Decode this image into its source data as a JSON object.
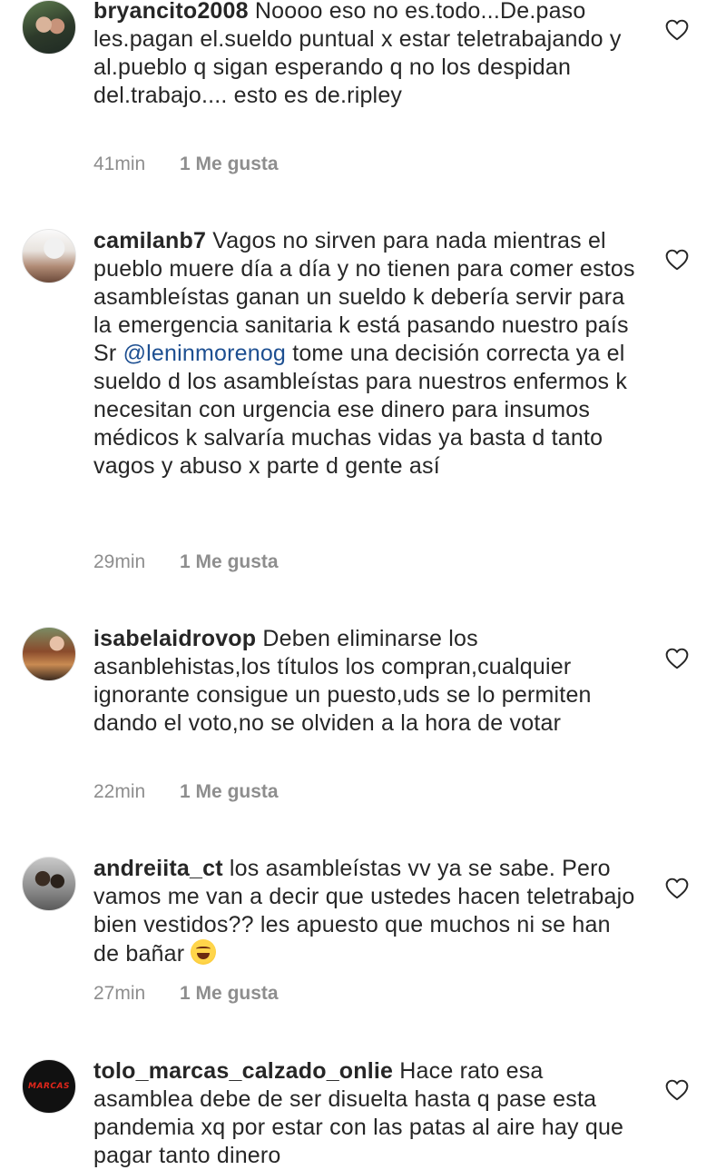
{
  "comments": [
    {
      "username": "bryancito2008",
      "text": "Noooo eso no es.todo...De.paso les.pagan el.sueldo puntual x estar teletrabajando y al.pueblo q sigan esperando q no los despidan del.trabajo.... esto es de.ripley",
      "time": "41min",
      "likes": "1 Me gusta"
    },
    {
      "username": "camilanb7",
      "text_before": "Vagos no sirven para nada mientras el pueblo muere día a día y no tienen para comer estos asambleístas ganan un sueldo k debería servir para la emergencia sanitaria k está pasando nuestro país Sr",
      "mention": "@leninmorenog",
      "text_after": "tome una decisión correcta ya el sueldo d los asambleístas para nuestros enfermos k necesitan con urgencia ese dinero para insumos médicos k salvaría muchas vidas ya basta d tanto vagos y abuso x parte d gente así",
      "time": "29min",
      "likes": "1 Me gusta"
    },
    {
      "username": "isabelaidrovop",
      "text": "Deben eliminarse los asanblehistas,los títulos los compran,cualquier ignorante consigue un puesto,uds se lo permiten dando el voto,no se olviden a la hora de votar",
      "time": "22min",
      "likes": "1 Me gusta"
    },
    {
      "username": "andreiita_ct",
      "text": "los asambleístas vv ya se sabe. Pero vamos me van a decir que ustedes hacen teletrabajo bien vestidos?? les apuesto que muchos ni se han de bañar",
      "emoji": "rolling-on-floor-laughing-emoji",
      "time": "27min",
      "likes": "1 Me gusta"
    },
    {
      "username": "tolo_marcas_calzado_onlie",
      "text": "Hace rato esa asamblea debe de ser disuelta hasta q pase esta pandemia xq por estar con las patas al aire hay que pagar tanto dinero",
      "avatar_logo": "MARCAS"
    }
  ],
  "icons": {
    "heart": "heart-outline-icon"
  },
  "colors": {
    "text": "#262626",
    "meta": "#8e8e8e",
    "mention": "#1d4f91"
  }
}
